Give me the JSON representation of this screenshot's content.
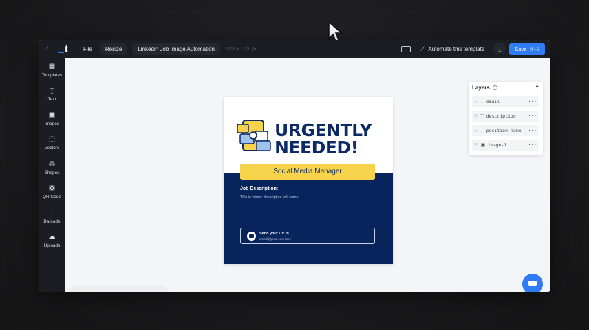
{
  "topbar": {
    "file": "File",
    "resize": "Resize",
    "template_name": "Linkedin Job Image Automation",
    "size": "1200 × 1200 px",
    "automate": "Automate this template",
    "save": "Save",
    "save_shortcut": "⌘+S"
  },
  "sidebar": {
    "items": [
      {
        "label": "Templates",
        "icon": "templates-icon"
      },
      {
        "label": "Text",
        "icon": "text-icon"
      },
      {
        "label": "Images",
        "icon": "image-icon"
      },
      {
        "label": "Vectors",
        "icon": "vector-icon"
      },
      {
        "label": "Shapes",
        "icon": "shapes-icon"
      },
      {
        "label": "QR Code",
        "icon": "qr-icon"
      },
      {
        "label": "Barcode",
        "icon": "barcode-icon"
      },
      {
        "label": "Uploads",
        "icon": "upload-icon"
      }
    ]
  },
  "card": {
    "headline_1": "URGENTLY",
    "headline_2": "NEEDED!",
    "position": "Social Media Manager",
    "jd_label": "Job Description:",
    "jd_text": "This is where description will come",
    "cv_title": "Send your CV to",
    "cv_email": "email@gmail.com here"
  },
  "layers": {
    "title": "Layers",
    "items": [
      "email",
      "description",
      "position name",
      "image-1"
    ]
  },
  "colors": {
    "accent": "#2f7cf6",
    "navy": "#08245c",
    "yellow": "#f6d34a"
  }
}
